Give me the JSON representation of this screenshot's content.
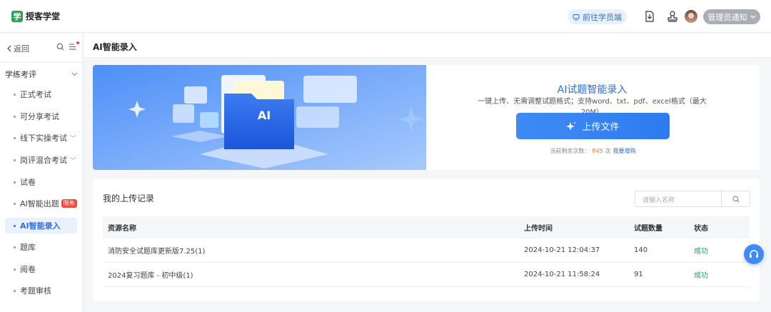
{
  "app": {
    "brand_name": "授客学堂",
    "brand_logo_char": "学"
  },
  "header": {
    "student_link": "前往学员端",
    "notice_label": "管理员通知"
  },
  "sidebar": {
    "back_label": "返回",
    "section_label": "学练考评",
    "items": [
      {
        "label": "正式考试"
      },
      {
        "label": "可分享考试"
      },
      {
        "label": "线下实操考试"
      },
      {
        "label": "岗评混合考试"
      },
      {
        "label": "试卷"
      },
      {
        "label": "AI智能出题",
        "badge": "限免"
      },
      {
        "label": "AI智能录入"
      },
      {
        "label": "题库"
      },
      {
        "label": "阅卷"
      },
      {
        "label": "考题审核"
      }
    ]
  },
  "page": {
    "title": "AI智能录入"
  },
  "banner": {
    "art_label": "AI",
    "title": "AI试题智能录入",
    "desc": "一键上传、无需调整试题格式；支持word、txt、pdf、excel格式（最大20M）",
    "upload_label": "上传文件",
    "remain_prefix": "当前剩余次数：",
    "remain_count": "845",
    "remain_unit": "次",
    "more_link": "我要增购"
  },
  "records": {
    "title": "我的上传记录",
    "search_placeholder": "请输入名称",
    "columns": [
      "资源名称",
      "上传时间",
      "试题数量",
      "状态"
    ],
    "rows": [
      [
        "消防安全试题库更新版7.25(1)",
        "2024-10-21 12:04:37",
        "140",
        "成功"
      ],
      [
        "2024复习题库 - 初中级(1)",
        "2024-10-21 11:58:24",
        "91",
        "成功"
      ]
    ]
  },
  "colors": {
    "accent": "#2d6fe0",
    "success": "#2ea361",
    "badge": "#f04a3e"
  }
}
